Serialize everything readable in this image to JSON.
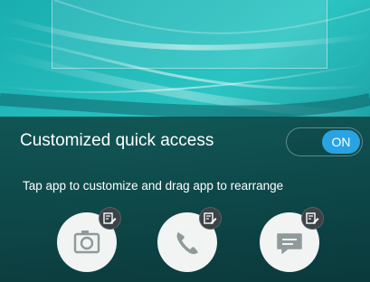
{
  "quick_access": {
    "title": "Customized quick access",
    "toggle_state": "ON",
    "hint": "Tap app to customize and drag app to rearrange",
    "apps": [
      {
        "name": "camera",
        "icon": "camera-icon",
        "badge_icon": "edit-icon"
      },
      {
        "name": "phone",
        "icon": "phone-icon",
        "badge_icon": "edit-icon"
      },
      {
        "name": "messaging",
        "icon": "message-icon",
        "badge_icon": "edit-icon"
      }
    ]
  },
  "colors": {
    "toggle_on": "#2aa3e3",
    "panel_bg": "#0e4747",
    "icon_circle": "#f2f3f3",
    "icon_glyph": "#8f9a9a",
    "badge_bg": "#3b4347"
  }
}
